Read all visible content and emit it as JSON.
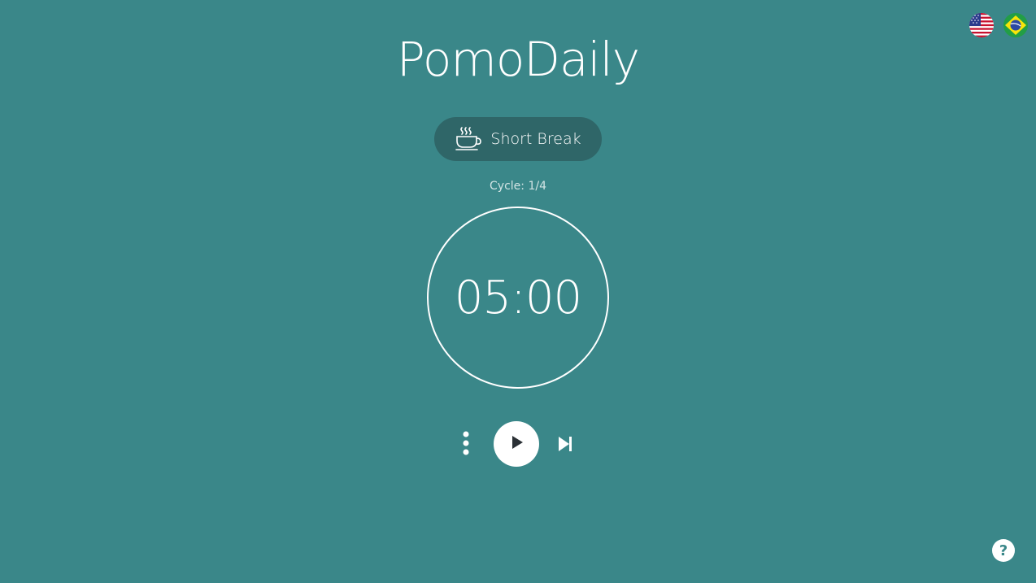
{
  "app": {
    "title": "PomoDaily"
  },
  "languages": [
    {
      "name": "english",
      "icon": "us-flag-icon"
    },
    {
      "name": "portuguese",
      "icon": "brazil-flag-icon"
    }
  ],
  "mode": {
    "label": "Short Break",
    "icon": "coffee-cup-icon"
  },
  "cycle": {
    "text": "Cycle: 1/4"
  },
  "timer": {
    "value": "05:00"
  },
  "controls": {
    "menu_icon": "more-vertical-icon",
    "play_icon": "play-icon",
    "skip_icon": "skip-next-icon"
  },
  "help": {
    "label": "?"
  },
  "colors": {
    "background": "#3a8789",
    "pill": "#2f6668",
    "foreground": "#ffffff"
  }
}
